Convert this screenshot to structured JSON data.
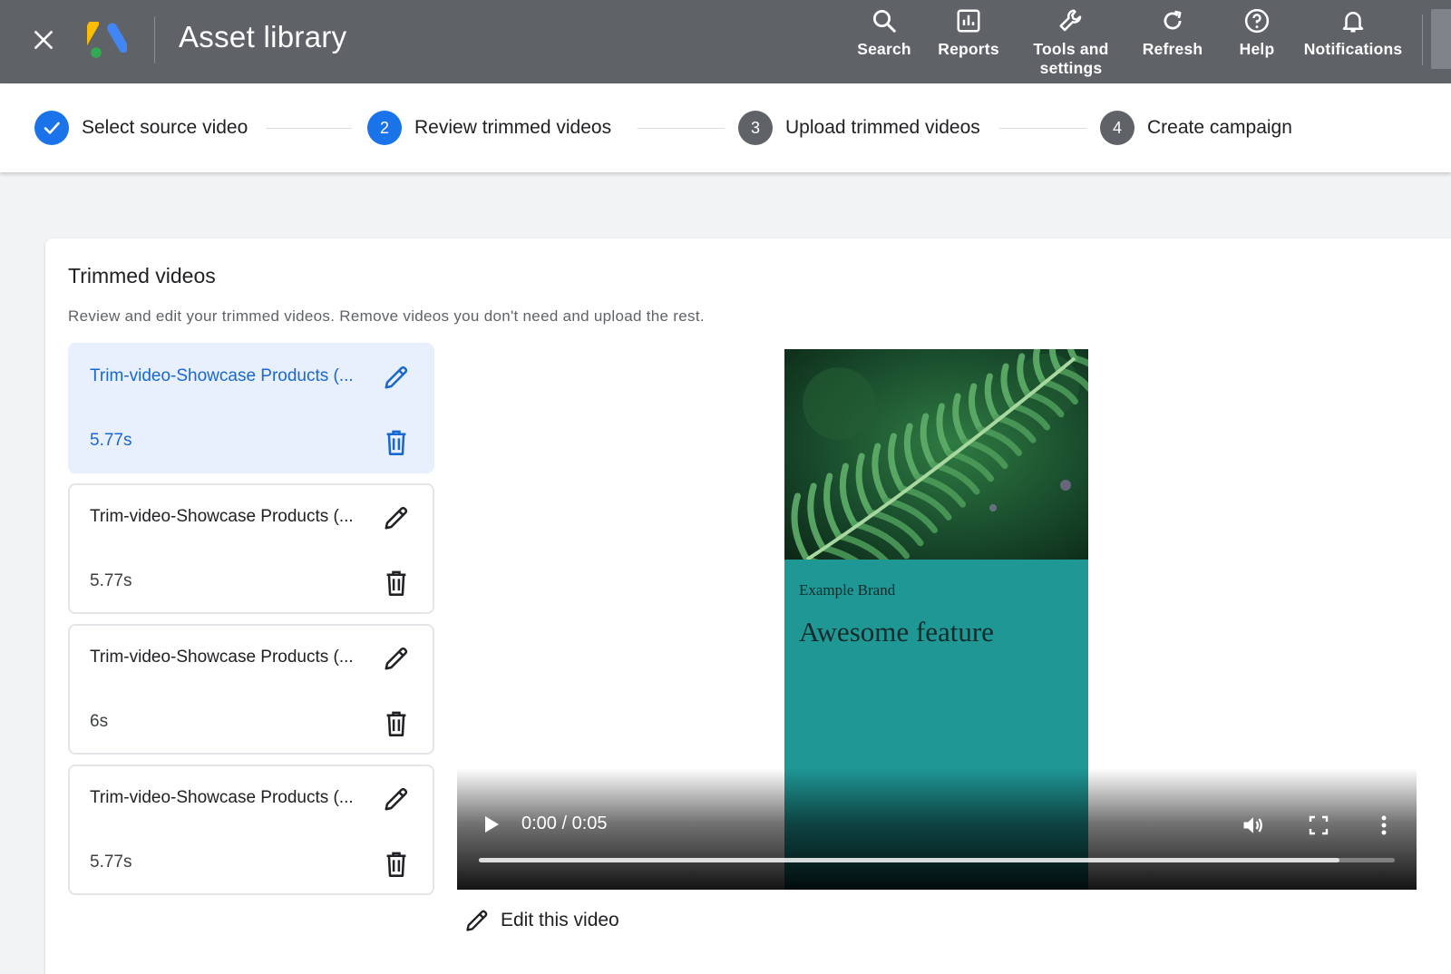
{
  "header": {
    "title": "Asset library",
    "actions": [
      {
        "label": "Search",
        "icon": "search-icon"
      },
      {
        "label": "Reports",
        "icon": "reports-icon"
      },
      {
        "label": "Tools and\nsettings",
        "icon": "wrench-icon"
      },
      {
        "label": "Refresh",
        "icon": "refresh-icon"
      },
      {
        "label": "Help",
        "icon": "help-icon"
      },
      {
        "label": "Notifications",
        "icon": "bell-icon"
      }
    ]
  },
  "stepper": {
    "steps": [
      {
        "number": "",
        "label": "Select source video",
        "state": "done"
      },
      {
        "number": "2",
        "label": "Review trimmed videos",
        "state": "active"
      },
      {
        "number": "3",
        "label": "Upload trimmed videos",
        "state": "pending"
      },
      {
        "number": "4",
        "label": "Create campaign",
        "state": "pending"
      }
    ]
  },
  "card": {
    "title": "Trimmed videos",
    "description": "Review and edit your trimmed videos. Remove videos you don't need and upload the rest."
  },
  "videos": [
    {
      "name": "Trim-video-Showcase Products (...",
      "duration": "5.77s",
      "selected": true
    },
    {
      "name": "Trim-video-Showcase Products (...",
      "duration": "5.77s",
      "selected": false
    },
    {
      "name": "Trim-video-Showcase Products (...",
      "duration": "6s",
      "selected": false
    },
    {
      "name": "Trim-video-Showcase Products (...",
      "duration": "5.77s",
      "selected": false
    }
  ],
  "player": {
    "brand": "Example Brand",
    "headline": "Awesome feature",
    "time": "0:00 / 0:05",
    "buffered_fraction": 0.94
  },
  "edit_video_label": "Edit this video",
  "colors": {
    "topbar": "#5f6368",
    "accent": "#1a73e8",
    "selected_bg": "#e8f0fe",
    "selected_text": "#1967d2",
    "teal": "#1f9795"
  }
}
